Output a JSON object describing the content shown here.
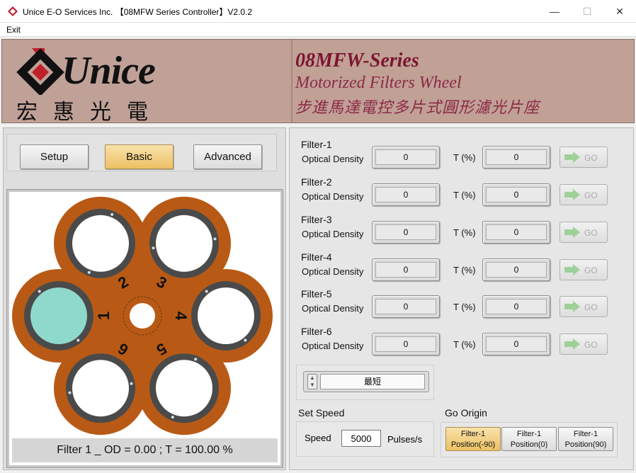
{
  "window": {
    "title": "Unice E-O Services Inc. 【08MFW Series Controller】V2.0.2",
    "controls": {
      "minimize": "—",
      "maximize": "☐",
      "close": "✕"
    }
  },
  "menu": {
    "items": [
      "Exit"
    ]
  },
  "banner": {
    "logo_word": "Unice",
    "logo_chinese": "宏惠光電",
    "series": "08MFW-Series",
    "product": "Motorized Filters Wheel",
    "product_chinese": "步進馬達電控多片式圓形濾光片座"
  },
  "modes": {
    "setup": "Setup",
    "basic": "Basic",
    "advanced": "Advanced",
    "active": "Basic"
  },
  "wheel": {
    "position_labels": [
      "1",
      "2",
      "3",
      "4",
      "5",
      "6"
    ],
    "selected_position": 1,
    "colors": {
      "body": "#b85a15",
      "ring": "#4a4a4a",
      "selected_filter": "#8ed9cc"
    },
    "status": "Filter 1 _ OD = 0.00 ; T = 100.00 %"
  },
  "filters": [
    {
      "title": "Filter-1",
      "od_label": "Optical Density",
      "od": "0",
      "t_label": "T (%)",
      "t": "0",
      "go": "GO"
    },
    {
      "title": "Filter-2",
      "od_label": "Optical Density",
      "od": "0",
      "t_label": "T (%)",
      "t": "0",
      "go": "GO"
    },
    {
      "title": "Filter-3",
      "od_label": "Optical Density",
      "od": "0",
      "t_label": "T (%)",
      "t": "0",
      "go": "GO"
    },
    {
      "title": "Filter-4",
      "od_label": "Optical Density",
      "od": "0",
      "t_label": "T (%)",
      "t": "0",
      "go": "GO"
    },
    {
      "title": "Filter-5",
      "od_label": "Optical Density",
      "od": "0",
      "t_label": "T (%)",
      "t": "0",
      "go": "GO"
    },
    {
      "title": "Filter-6",
      "od_label": "Optical Density",
      "od": "0",
      "t_label": "T (%)",
      "t": "0",
      "go": "GO"
    }
  ],
  "speed_mode": {
    "value": "最短"
  },
  "set_speed": {
    "title": "Set Speed",
    "label": "Speed",
    "value": "5000",
    "unit": "Pulses/s"
  },
  "go_origin": {
    "title": "Go Origin",
    "buttons": [
      {
        "line1": "Filter-1",
        "line2": "Position(-90)"
      },
      {
        "line1": "Filter-1",
        "line2": "Position(0)"
      },
      {
        "line1": "Filter-1",
        "line2": "Position(90)"
      }
    ]
  }
}
